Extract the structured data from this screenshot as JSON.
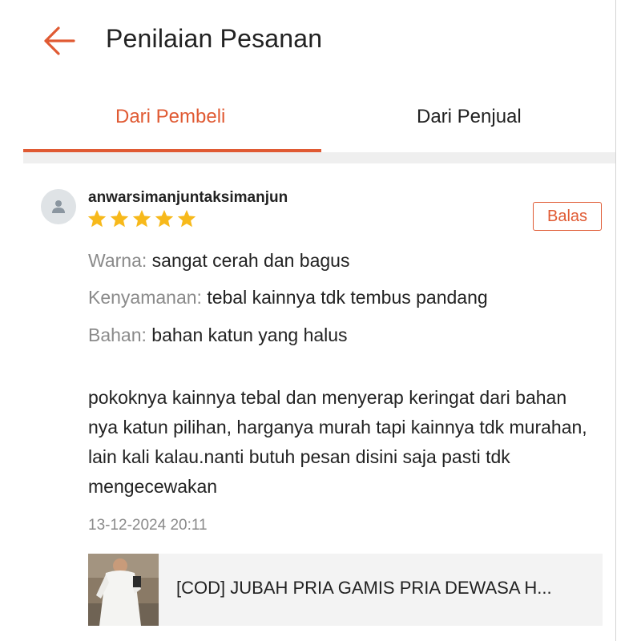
{
  "header": {
    "title": "Penilaian Pesanan",
    "back_icon": "arrow-left-icon"
  },
  "tabs": [
    {
      "label": "Dari Pembeli",
      "active": true
    },
    {
      "label": "Dari Penjual",
      "active": false
    }
  ],
  "colors": {
    "accent": "#e05a33",
    "star": "#f7b91b",
    "muted": "#8a8a8a"
  },
  "review": {
    "username": "anwarsimanjuntaksimanjun",
    "rating": 5,
    "reply_label": "Balas",
    "attributes": [
      {
        "label": "Warna:",
        "value": "sangat cerah dan bagus"
      },
      {
        "label": "Kenyamanan:",
        "value": "tebal kainnya tdk tembus pandang"
      },
      {
        "label": "Bahan:",
        "value": "bahan katun yang halus"
      }
    ],
    "body": "pokoknya kainnya tebal dan menyerap keringat dari bahan nya katun pilihan, harganya murah tapi kainnya tdk murahan, lain kali kalau.nanti butuh pesan disini saja pasti tdk mengecewakan",
    "date": "13-12-2024 20:11"
  },
  "product": {
    "name": "[COD] JUBAH PRIA GAMIS PRIA DEWASA H..."
  }
}
